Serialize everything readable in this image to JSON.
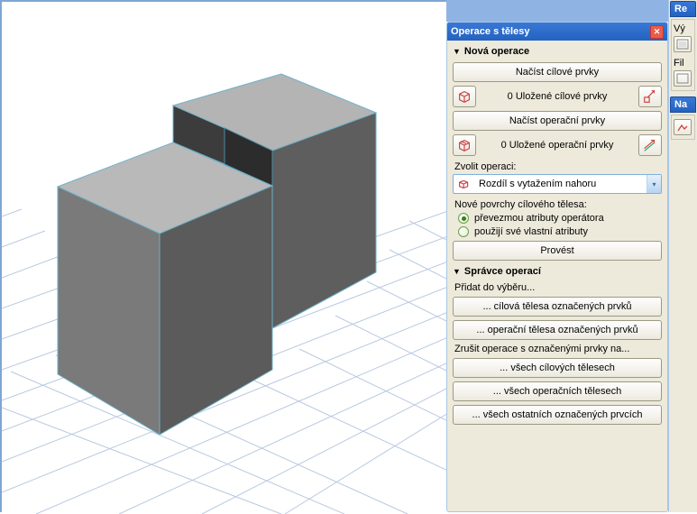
{
  "panel": {
    "title": "Operace s tělesy",
    "section_nova": "Nová operace",
    "btn_load_target": "Načíst cílové prvky",
    "stored_target": "0  Uložené cílové prvky",
    "btn_load_oper": "Načíst operační prvky",
    "stored_oper": "0  Uložené operační prvky",
    "choose_op_label": "Zvolit operaci:",
    "dropdown_text": "Rozdíl s vytažením nahoru",
    "new_surfaces_label": "Nové povrchy cílového tělesa:",
    "radio1": "převezmou atributy operátora",
    "radio2": "použijí své vlastní atributy",
    "btn_execute": "Provést",
    "section_manager": "Správce operací",
    "add_to_sel": "Přidat do výběru...",
    "btn_target_bodies": "... cílová tělesa označených prvků",
    "btn_oper_bodies": "... operační tělesa označených prvků",
    "cancel_ops_label": "Zrušit operace s označenými prvky na...",
    "btn_all_target": "... všech cílových tělesech",
    "btn_all_oper": "... všech operačních tělesech",
    "btn_all_other": "... všech ostatních označených prvcích"
  },
  "right": {
    "tab1": "Re",
    "label1": "Vý",
    "label2": "Fil",
    "tab2": "Na"
  }
}
